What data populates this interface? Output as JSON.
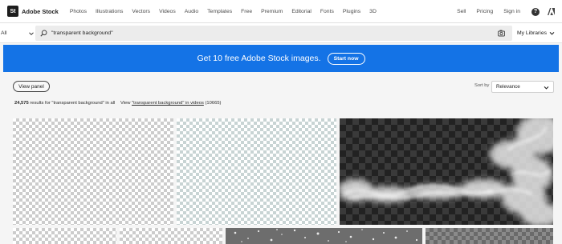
{
  "header": {
    "logo_mark": "St",
    "logo_text": "Adobe Stock",
    "nav": [
      "Photos",
      "Illustrations",
      "Vectors",
      "Videos",
      "Audio",
      "Templates",
      "Free",
      "Premium",
      "Editorial",
      "Fonts",
      "Plugins",
      "3D"
    ],
    "right_links": {
      "sell": "Sell",
      "pricing": "Pricing",
      "sign_in": "Sign in"
    },
    "help_label": "?"
  },
  "search": {
    "scope": "All",
    "query": "\"transparent background\"",
    "my_libraries": "My Libraries"
  },
  "banner": {
    "text": "Get 10 free Adobe Stock images.",
    "button": "Start now",
    "color": "#1473e6"
  },
  "toolbar": {
    "view_panel": "View panel",
    "sort_label": "Sort by",
    "sort_value": "Relevance"
  },
  "results": {
    "count": "24,575",
    "text": "results for \"transparent background\" in all",
    "view_prefix": "View",
    "view_link": "\"transparent background\" in videos",
    "video_count": "(10665)"
  },
  "tiles": [
    {
      "kind": "checkerboard-light"
    },
    {
      "kind": "checkerboard-teal"
    },
    {
      "kind": "smoke-on-dark-checkerboard"
    },
    {
      "kind": "checkerboard-light"
    },
    {
      "kind": "checkerboard-light"
    },
    {
      "kind": "snow-particles-on-gray"
    },
    {
      "kind": "checkerboard-gray"
    }
  ]
}
